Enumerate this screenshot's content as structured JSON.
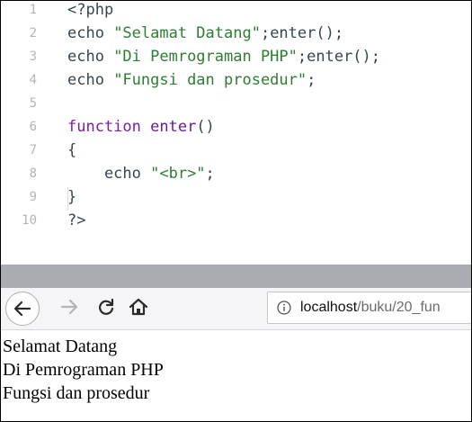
{
  "editor": {
    "lines": [
      {
        "num": "1",
        "parts": [
          {
            "cls": "ph",
            "t": "<?php"
          }
        ]
      },
      {
        "num": "2",
        "parts": [
          {
            "cls": "ph",
            "t": "echo "
          },
          {
            "cls": "str",
            "t": "\"Selamat Datang\""
          },
          {
            "cls": "ph",
            "t": ";enter();"
          }
        ]
      },
      {
        "num": "3",
        "parts": [
          {
            "cls": "ph",
            "t": "echo "
          },
          {
            "cls": "str",
            "t": "\"Di Pemrograman PHP\""
          },
          {
            "cls": "ph",
            "t": ";enter();"
          }
        ]
      },
      {
        "num": "4",
        "parts": [
          {
            "cls": "ph",
            "t": "echo "
          },
          {
            "cls": "str",
            "t": "\"Fungsi dan prosedur\""
          },
          {
            "cls": "ph",
            "t": ";"
          }
        ]
      },
      {
        "num": "5",
        "parts": []
      },
      {
        "num": "6",
        "parts": [
          {
            "cls": "kw",
            "t": "function "
          },
          {
            "cls": "fn",
            "t": "enter"
          },
          {
            "cls": "ph",
            "t": "()"
          }
        ]
      },
      {
        "num": "7",
        "parts": [
          {
            "cls": "ph",
            "t": "{"
          }
        ]
      },
      {
        "num": "8",
        "parts": [
          {
            "cls": "ph",
            "t": "    echo "
          },
          {
            "cls": "str",
            "t": "\"<br>\""
          },
          {
            "cls": "ph",
            "t": ";"
          }
        ]
      },
      {
        "num": "9",
        "parts": [
          {
            "cls": "ph",
            "t": "}"
          }
        ]
      },
      {
        "num": "10",
        "parts": [
          {
            "cls": "ph",
            "t": "?>"
          }
        ]
      }
    ]
  },
  "browser": {
    "url_host": "localhost",
    "url_path": "/buku/20_fun",
    "icons": [
      "back-arrow-icon",
      "forward-arrow-icon",
      "reload-icon",
      "home-icon",
      "info-icon"
    ]
  },
  "page": {
    "lines": [
      "Selamat Datang",
      "Di Pemrograman PHP",
      "Fungsi dan prosedur"
    ]
  },
  "colors": {
    "keyword": "#7b1fa2",
    "string": "#2e7d32",
    "separator": "#a9adb1"
  }
}
